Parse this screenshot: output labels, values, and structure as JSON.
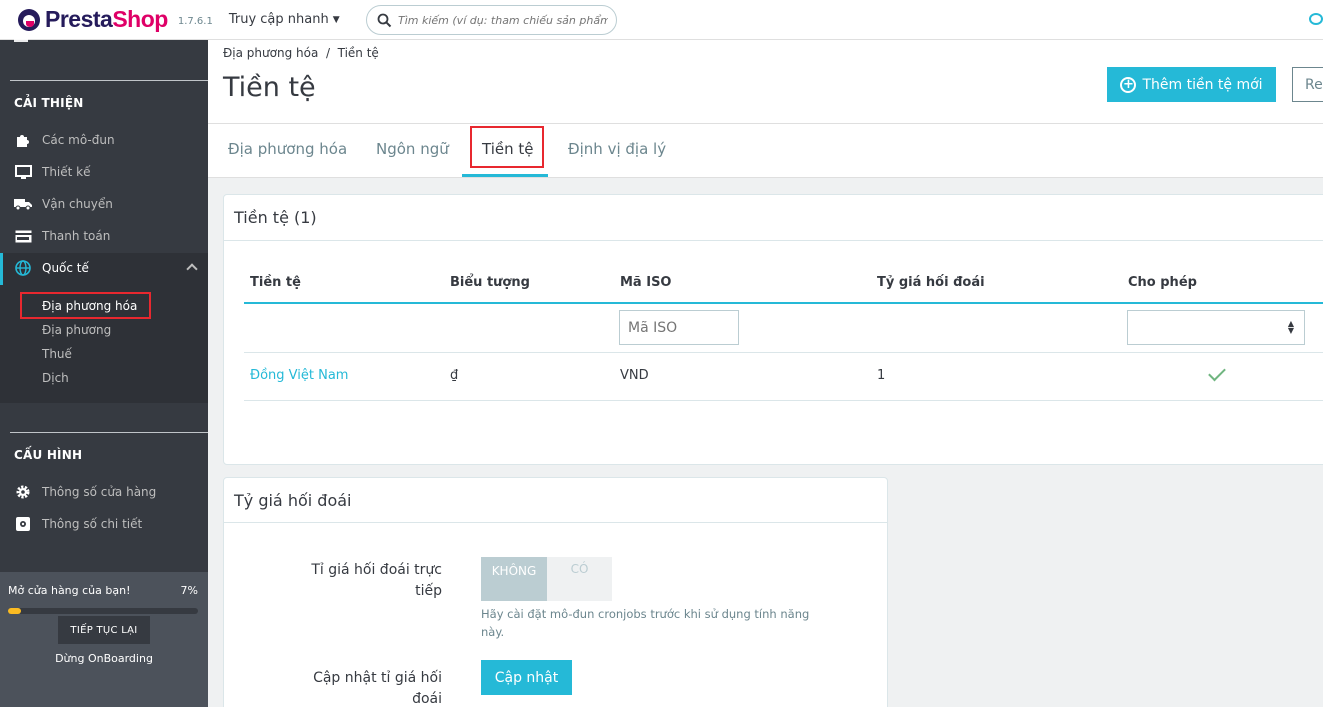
{
  "header": {
    "logo_presta": "Presta",
    "logo_shop": "Shop",
    "version": "1.7.6.1",
    "quick_access": "Truy cập nhanh",
    "search_placeholder": "Tìm kiếm (ví dụ: tham chiếu sản phẩm, t"
  },
  "sidebar": {
    "section_improve": "CẢI THIỆN",
    "items": [
      {
        "label": "Các mô-đun",
        "icon": "puzzle-icon"
      },
      {
        "label": "Thiết kế",
        "icon": "monitor-icon"
      },
      {
        "label": "Vận chuyển",
        "icon": "truck-icon"
      },
      {
        "label": "Thanh toán",
        "icon": "credit-card-icon"
      },
      {
        "label": "Quốc tế",
        "icon": "globe-icon"
      }
    ],
    "sub_items": [
      {
        "label": "Địa phương hóa"
      },
      {
        "label": "Địa phương"
      },
      {
        "label": "Thuế"
      },
      {
        "label": "Dịch"
      }
    ],
    "section_config": "CẤU HÌNH",
    "config_items": [
      {
        "label": "Thông số cửa hàng",
        "icon": "gear-icon"
      },
      {
        "label": "Thông số chi tiết",
        "icon": "settings-box-icon"
      }
    ],
    "onboarding": {
      "text": "Mở cửa hàng của bạn!",
      "percent_text": "7%",
      "progress": 0.07,
      "continue_label": "TIẾP TỤC LẠI",
      "stop_label": "Dừng OnBoarding"
    }
  },
  "page": {
    "breadcrumb": "Địa phương hóa  /  Tiền tệ",
    "title": "Tiền tệ",
    "add_button": "Thêm tiền tệ mới",
    "second_button": "Re",
    "tabs": [
      {
        "label": "Địa phương hóa"
      },
      {
        "label": "Ngôn ngữ"
      },
      {
        "label": "Tiền tệ"
      },
      {
        "label": "Định vị địa lý"
      }
    ]
  },
  "currencies": {
    "title": "Tiền tệ (1)",
    "columns": [
      "Tiền tệ",
      "Biểu tượng",
      "Mã ISO",
      "Tỷ giá hối đoái",
      "Cho phép"
    ],
    "iso_filter_placeholder": "Mã ISO",
    "rows": [
      {
        "name": "Đồng Việt Nam",
        "symbol": "₫",
        "iso": "VND",
        "rate": "1",
        "enabled": true
      }
    ]
  },
  "exchange": {
    "title": "Tỷ giá hối đoái",
    "live_label": "Tỉ giá hối đoái trực tiếp",
    "switch_off": "KHÔNG",
    "switch_on": "CÓ",
    "help": "Hãy cài đặt mô-đun cronjobs trước khi sử dụng tính năng này.",
    "update_label": "Cập nhật tỉ giá hối đoái",
    "update_button": "Cập nhật"
  },
  "colors": {
    "accent": "#25b9d7",
    "sidebar": "#363a41",
    "highlight": "#e8282f",
    "progress": "#fbbb22",
    "success": "#70b580"
  }
}
